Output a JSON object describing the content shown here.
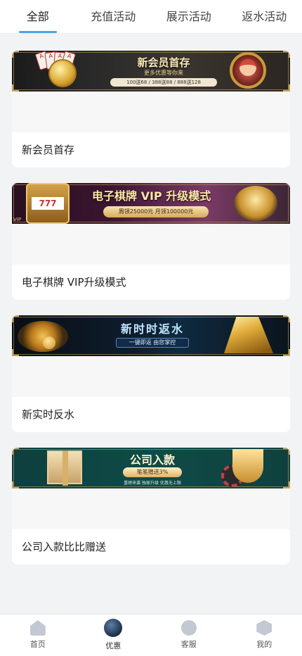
{
  "tabs": [
    {
      "label": "全部"
    },
    {
      "label": "充值活动"
    },
    {
      "label": "展示活动"
    },
    {
      "label": "返水活动"
    }
  ],
  "promotions": [
    {
      "title": "新会员首存",
      "banner": {
        "headline": "新会员首存",
        "subline": "更多优惠等你来",
        "detail": "100送68 / 388送88 / 888送128"
      }
    },
    {
      "title": "电子棋牌 VIP升级模式",
      "banner": {
        "headline": "电子棋牌 VIP 升级模式",
        "detail": "周领25000元  月领100000元",
        "badge": "VIP"
      }
    },
    {
      "title": "新实时反水",
      "banner": {
        "headline": "新时时返水",
        "detail": "一键即返  由您掌控"
      }
    },
    {
      "title": "公司入款比比赠送",
      "banner": {
        "headline": "公司入款",
        "detail": "笔笔赠送3%",
        "subline": "重磅来袭  独家升级  优惠无上限"
      }
    }
  ],
  "bottom_nav": [
    {
      "label": "首页",
      "icon": "home-icon"
    },
    {
      "label": "优惠",
      "icon": "promo-icon"
    },
    {
      "label": "客服",
      "icon": "chat-icon"
    },
    {
      "label": "我的",
      "icon": "profile-icon"
    }
  ],
  "colors": {
    "active_tab_indicator": "#4da3e6",
    "page_background": "#f2f3f5",
    "card_background": "#ffffff"
  }
}
